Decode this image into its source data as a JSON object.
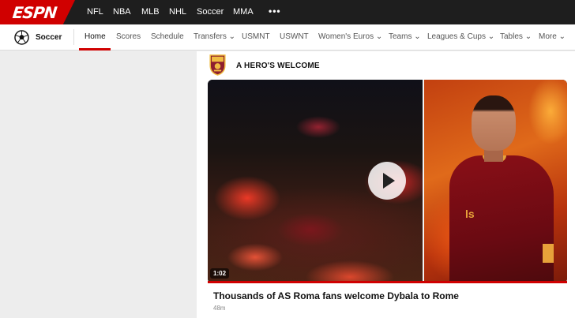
{
  "brand": {
    "logo_text": "ESPN",
    "color": "#d00000"
  },
  "top_nav": {
    "items": [
      "NFL",
      "NBA",
      "MLB",
      "NHL",
      "Soccer",
      "MMA"
    ],
    "more": "•••"
  },
  "sub_nav": {
    "section": "Soccer",
    "items": [
      {
        "label": "Home",
        "active": true
      },
      {
        "label": "Scores"
      },
      {
        "label": "Schedule"
      },
      {
        "label": "Transfers",
        "dropdown": true
      },
      {
        "label": "USMNT"
      },
      {
        "label": "USWNT"
      },
      {
        "label": "Women's Euros",
        "dropdown": true
      },
      {
        "label": "Teams",
        "dropdown": true
      },
      {
        "label": "Leagues & Cups",
        "dropdown": true
      },
      {
        "label": "Tables",
        "dropdown": true
      },
      {
        "label": "More",
        "dropdown": true
      }
    ]
  },
  "story": {
    "headline": "A HERO'S WELCOME",
    "badge_icon": "as-roma-crest-icon",
    "video": {
      "duration": "1:02",
      "play_icon": "play-icon",
      "shirt_text": "ls",
      "title": "Thousands of AS Roma fans welcome Dybala to Rome",
      "time_ago": "48m"
    }
  }
}
